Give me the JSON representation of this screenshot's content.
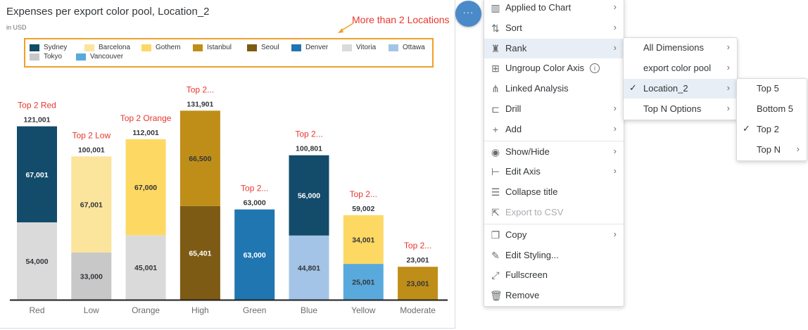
{
  "chart_panel": {
    "title": "Expenses per export color pool, Location_2",
    "subtitle": "in USD",
    "annotation": "More than 2 Locations",
    "legend": [
      {
        "name": "Sydney",
        "color": "#134b6b"
      },
      {
        "name": "Barcelona",
        "color": "#fbe49c"
      },
      {
        "name": "Gothem",
        "color": "#fdd863"
      },
      {
        "name": "Istanbul",
        "color": "#bf8e18"
      },
      {
        "name": "Seoul",
        "color": "#7d5b14"
      },
      {
        "name": "Denver",
        "color": "#2076b0"
      },
      {
        "name": "Vitoria",
        "color": "#dadada"
      },
      {
        "name": "Ottawa",
        "color": "#a3c4e6"
      },
      {
        "name": "Tokyo",
        "color": "#c8c8c8"
      },
      {
        "name": "Vancouver",
        "color": "#5aa9dc"
      }
    ]
  },
  "chart_data": {
    "type": "bar",
    "stacked": true,
    "categories": [
      "Red",
      "Low",
      "Orange",
      "High",
      "Green",
      "Blue",
      "Yellow",
      "Moderate"
    ],
    "top_labels": [
      "Top 2 Red",
      "Top 2 Low",
      "Top 2 Orange",
      "Top 2...",
      "Top 2...",
      "Top 2...",
      "Top 2...",
      "Top 2..."
    ],
    "totals": [
      "121,001",
      "100,001",
      "112,001",
      "131,901",
      "63,000",
      "100,801",
      "59,002",
      "23,001"
    ],
    "ylim": [
      0,
      135000
    ],
    "stacks": [
      [
        {
          "series": "Vitoria",
          "value": 54000,
          "label": "54,000"
        },
        {
          "series": "Sydney",
          "value": 67001,
          "label": "67,001"
        }
      ],
      [
        {
          "series": "Tokyo",
          "value": 33000,
          "label": "33,000"
        },
        {
          "series": "Barcelona",
          "value": 67001,
          "label": "67,001"
        }
      ],
      [
        {
          "series": "Vitoria",
          "value": 45001,
          "label": "45,001"
        },
        {
          "series": "Gothem",
          "value": 67000,
          "label": "67,000"
        }
      ],
      [
        {
          "series": "Seoul",
          "value": 65401,
          "label": "65,401"
        },
        {
          "series": "Istanbul",
          "value": 66500,
          "label": "66,500"
        }
      ],
      [
        {
          "series": "Denver",
          "value": 63000,
          "label": "63,000"
        }
      ],
      [
        {
          "series": "Ottawa",
          "value": 44801,
          "label": "44,801"
        },
        {
          "series": "Sydney",
          "value": 56000,
          "label": "56,000"
        }
      ],
      [
        {
          "series": "Vancouver",
          "value": 25001,
          "label": "25,001"
        },
        {
          "series": "Gothem",
          "value": 34001,
          "label": "34,001"
        }
      ],
      [
        {
          "series": "Istanbul",
          "value": 23001,
          "label": "23,001"
        }
      ]
    ]
  },
  "more_button": {
    "label": "···"
  },
  "context_menu": {
    "items": [
      {
        "label": "Applied to Chart",
        "icon": "chart-icon",
        "glyph": "▥",
        "chevron": true
      },
      {
        "label": "Sort",
        "icon": "sort-icon",
        "glyph": "⇅",
        "chevron": true
      },
      {
        "label": "Rank",
        "icon": "rank-icon",
        "glyph": "♜",
        "chevron": true,
        "selected": true
      },
      {
        "label": "Ungroup Color Axis",
        "icon": "ungroup-icon",
        "glyph": "⊞",
        "info": true
      },
      {
        "label": "Linked Analysis",
        "icon": "linked-analysis-icon",
        "glyph": "⋔"
      },
      {
        "label": "Drill",
        "icon": "drill-icon",
        "glyph": "⊏",
        "chevron": true
      },
      {
        "label": "Add",
        "icon": "add-icon",
        "glyph": "+",
        "chevron": true
      },
      {
        "label": "Show/Hide",
        "icon": "eye-icon",
        "glyph": "◉",
        "chevron": true
      },
      {
        "label": "Edit Axis",
        "icon": "edit-axis-icon",
        "glyph": "⊢",
        "chevron": true
      },
      {
        "label": "Collapse title",
        "icon": "collapse-icon",
        "glyph": "☰"
      },
      {
        "label": "Export to CSV",
        "icon": "export-icon",
        "glyph": "⇱",
        "disabled": true
      },
      {
        "label": "Copy",
        "icon": "copy-icon",
        "glyph": "❐",
        "chevron": true
      },
      {
        "label": "Edit Styling...",
        "icon": "brush-icon",
        "glyph": "✎"
      },
      {
        "label": "Fullscreen",
        "icon": "fullscreen-icon",
        "glyph": "⤢"
      },
      {
        "label": "Remove",
        "icon": "trash-icon",
        "glyph": "🗑"
      }
    ]
  },
  "rank_menu": {
    "items": [
      {
        "label": "All Dimensions",
        "chevron": true
      },
      {
        "label": "export color pool",
        "chevron": true
      },
      {
        "label": "Location_2",
        "chevron": true,
        "checked": true,
        "selected": true
      },
      {
        "label": "Top N Options",
        "chevron": true
      }
    ]
  },
  "location_menu": {
    "items": [
      {
        "label": "Top 5"
      },
      {
        "label": "Bottom 5"
      },
      {
        "label": "Top 2",
        "checked": true
      },
      {
        "label": "Top N",
        "chevron": true
      }
    ]
  }
}
